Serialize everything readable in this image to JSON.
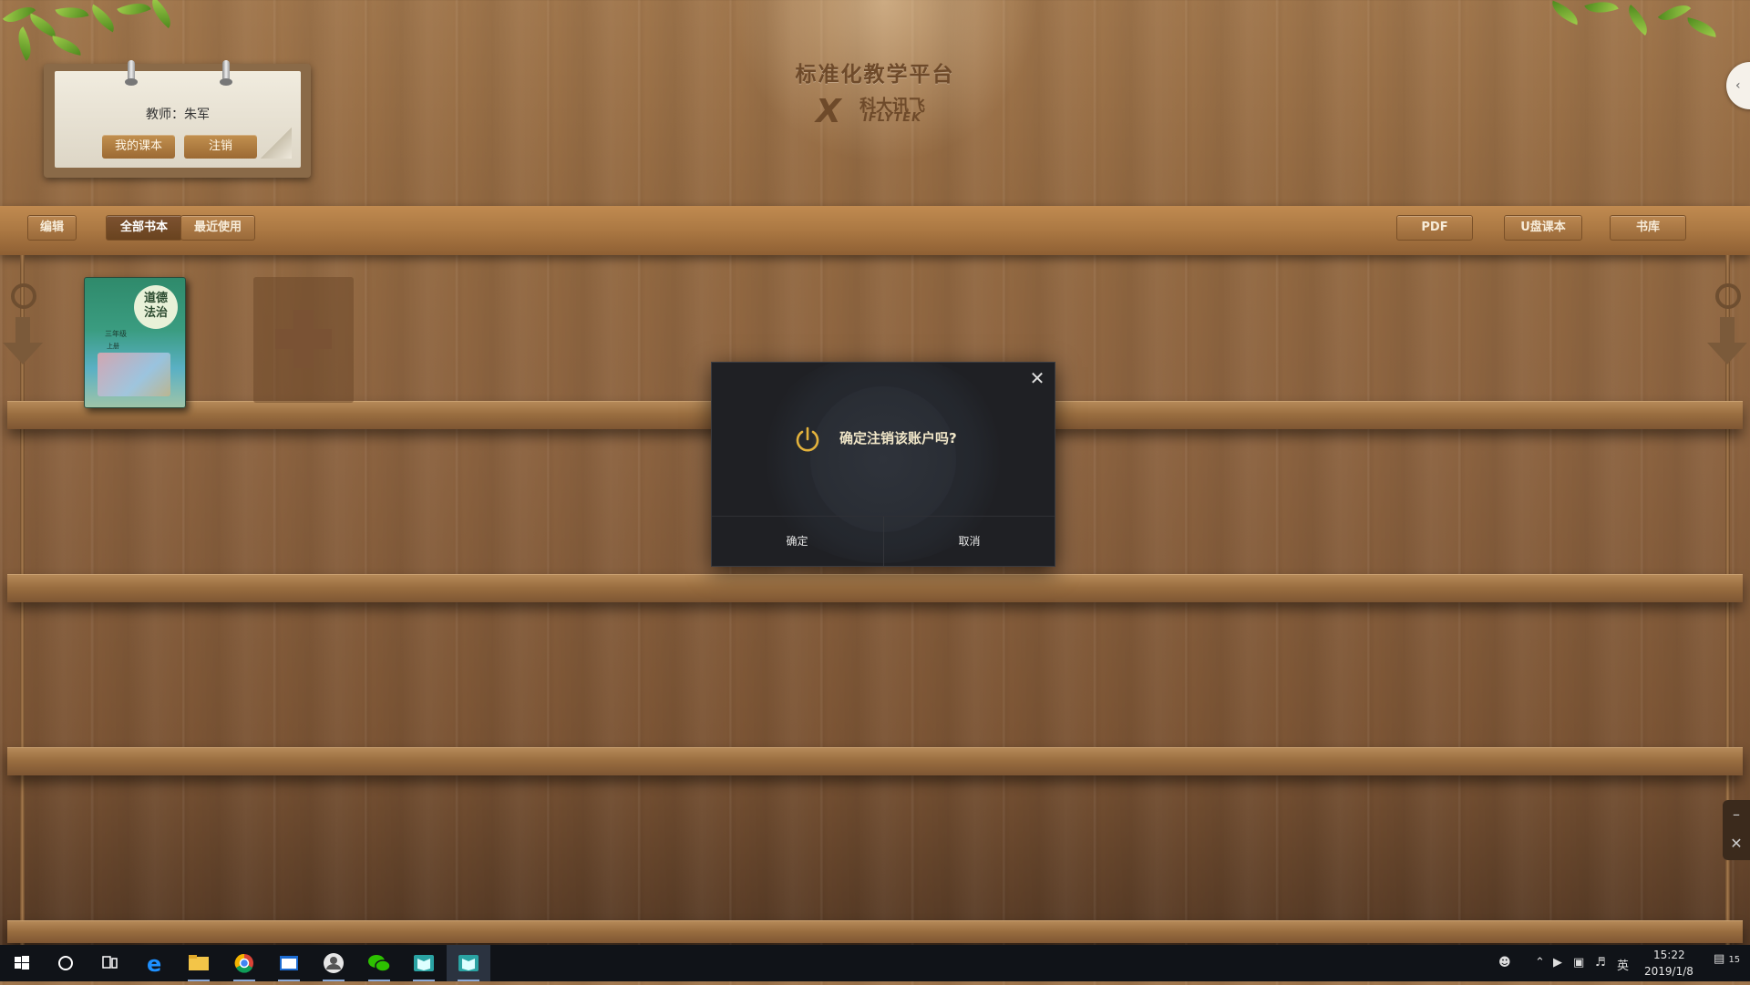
{
  "teacher_card": {
    "teacher_label": "教师：朱军",
    "my_textbooks_button": "我的课本",
    "logout_button": "注销"
  },
  "header": {
    "platform_title": "标准化教学平台",
    "brand_cn": "科大讯飞",
    "brand_en": "IFLYTEK",
    "collapse_icon": "chevron-left-icon"
  },
  "toolbar": {
    "edit_button": "编辑",
    "all_books_tab": "全部书本",
    "recent_tab": "最近使用",
    "pdf_button": "PDF",
    "usb_books_button": "U盘课本",
    "library_button": "书库"
  },
  "shelf": {
    "book": {
      "title": "道德与法治",
      "title_line1": "道德",
      "title_line2": "法治",
      "grade": "三年级",
      "term": "上册"
    },
    "add_book_icon": "plus-icon"
  },
  "dialog": {
    "message": "确定注销该账户吗?",
    "confirm_button": "确定",
    "cancel_button": "取消",
    "icon": "power-icon",
    "close_icon": "close-icon",
    "accent_color": "#e3b23c"
  },
  "side_controls": {
    "minimize_icon": "minus-icon",
    "close_icon": "close-icon"
  },
  "taskbar": {
    "time": "15:22",
    "date": "2019/1/8",
    "ime": "英",
    "notification_count": "15"
  }
}
